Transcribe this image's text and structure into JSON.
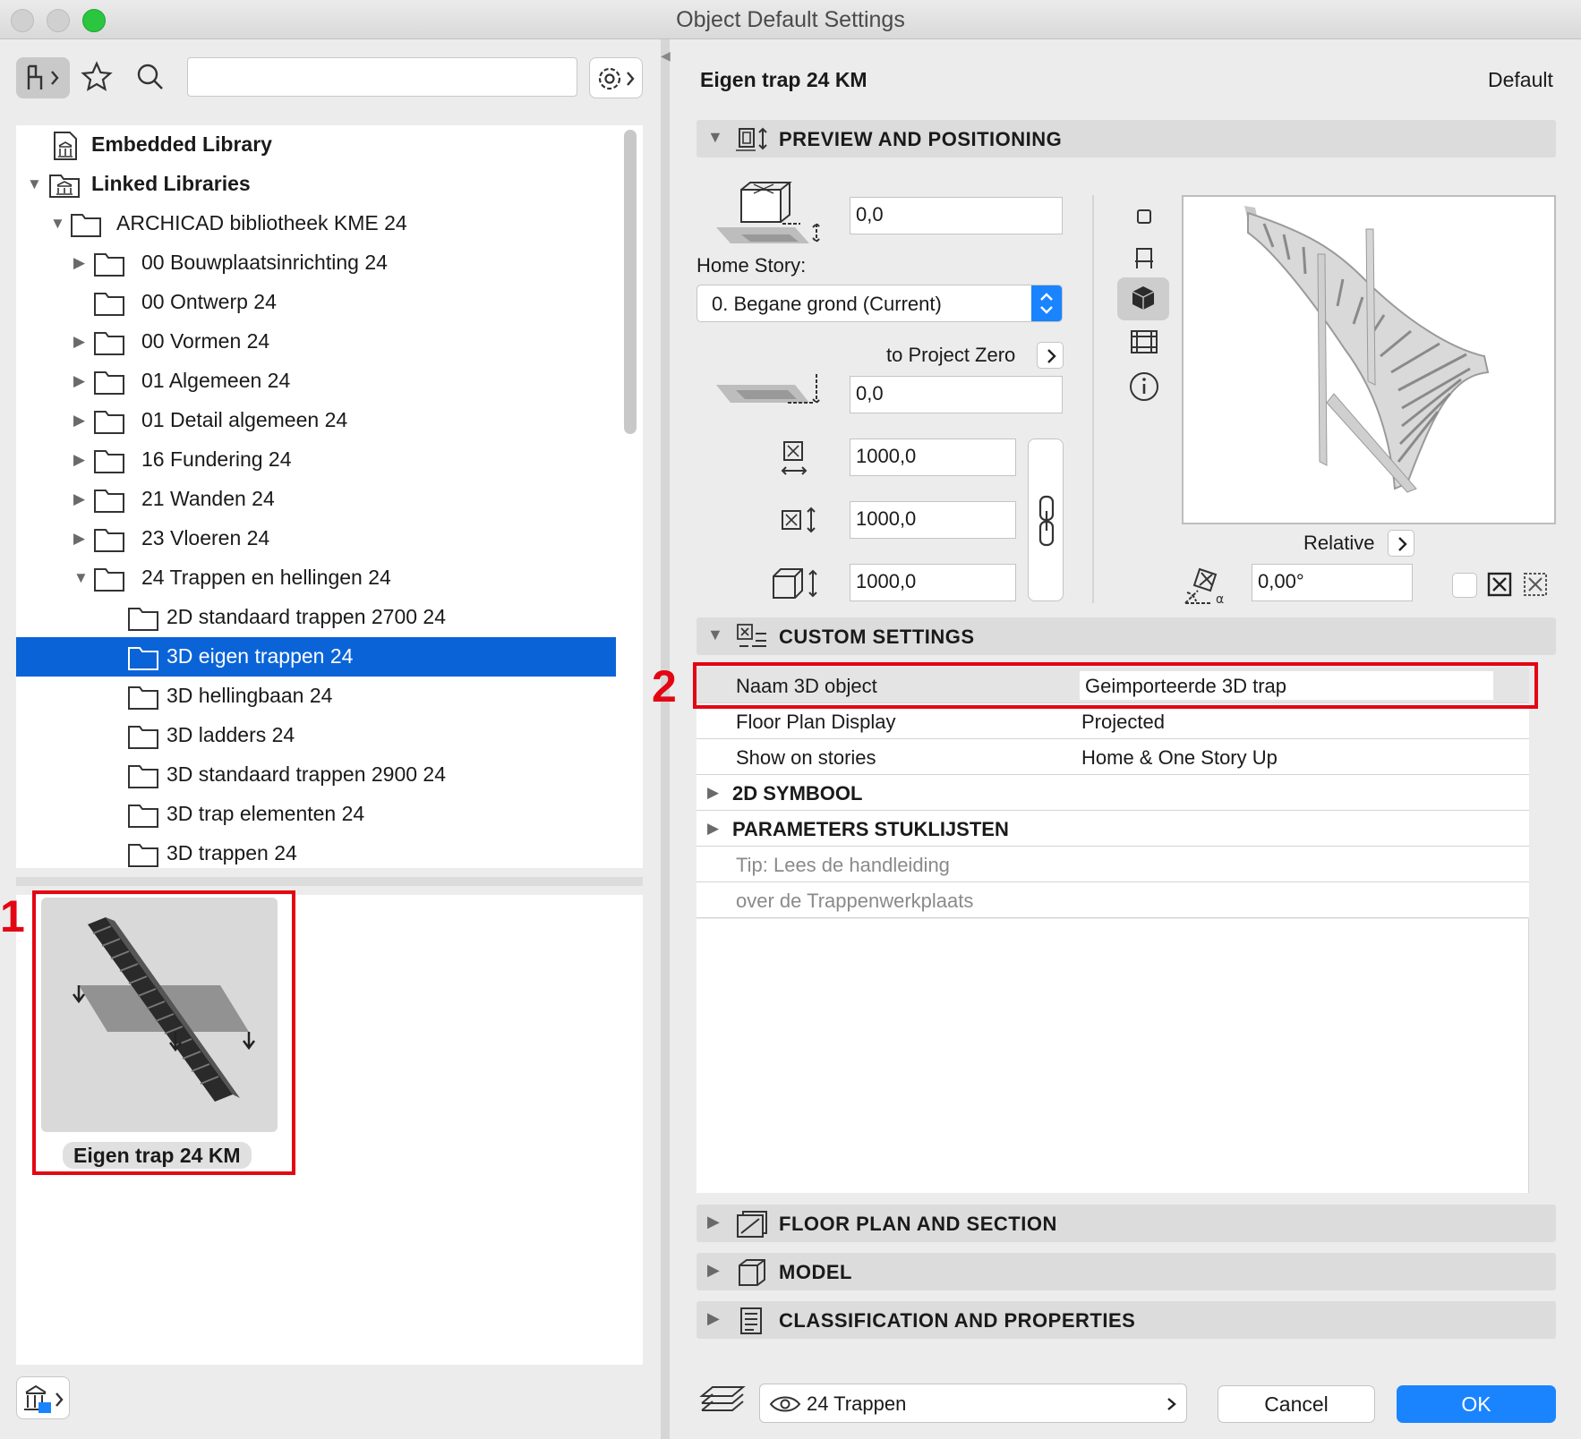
{
  "window": {
    "title": "Object Default Settings"
  },
  "library": {
    "embedded": "Embedded Library",
    "linked": "Linked Libraries",
    "root": "ARCHICAD bibliotheek KME 24",
    "folders": [
      "00 Bouwplaatsinrichting 24",
      "00 Ontwerp 24",
      "00 Vormen 24",
      "01 Algemeen 24",
      "01 Detail algemeen 24",
      "16 Fundering 24",
      "21 Wanden 24",
      "23 Vloeren 24",
      "24 Trappen en hellingen 24"
    ],
    "subfolders": [
      "2D standaard trappen 2700 24",
      "3D eigen trappen 24",
      "3D hellingbaan 24",
      "3D ladders 24",
      "3D standaard trappen 2900 24",
      "3D trap elementen 24",
      "3D trappen 24"
    ],
    "selected": "3D eigen trappen 24",
    "thumbnail_label": "Eigen trap 24 KM"
  },
  "annotations": {
    "one": "1",
    "two": "2"
  },
  "header": {
    "object_name": "Eigen trap 24 KM",
    "default_label": "Default"
  },
  "preview": {
    "section": "PREVIEW AND POSITIONING",
    "elevation": "0,0",
    "home_story_label": "Home Story:",
    "home_story": "0. Begane grond (Current)",
    "to_project_zero": "to Project Zero",
    "project_zero": "0,0",
    "x_size": "1000,0",
    "y_size": "1000,0",
    "z_size": "1000,0",
    "relative": "Relative",
    "angle": "0,00°"
  },
  "custom": {
    "section": "CUSTOM SETTINGS",
    "rows": [
      {
        "key": "Naam 3D object",
        "value": "Geimporteerde 3D trap"
      },
      {
        "key": "Floor Plan Display",
        "value": "Projected"
      },
      {
        "key": "Show on stories",
        "value": "Home & One Story Up"
      }
    ],
    "groups": [
      "2D SYMBOOL",
      "PARAMETERS STUKLIJSTEN"
    ],
    "tips": [
      "Tip: Lees de handleiding",
      "over de Trappenwerkplaats"
    ]
  },
  "sections": {
    "floor_plan": "FLOOR PLAN AND SECTION",
    "model": "MODEL",
    "classification": "CLASSIFICATION AND PROPERTIES"
  },
  "footer": {
    "layer": "24 Trappen",
    "cancel": "Cancel",
    "ok": "OK"
  },
  "colors": {
    "accent": "#0a64d8",
    "annotation": "#e30613",
    "ok_button": "#1a84ff"
  }
}
